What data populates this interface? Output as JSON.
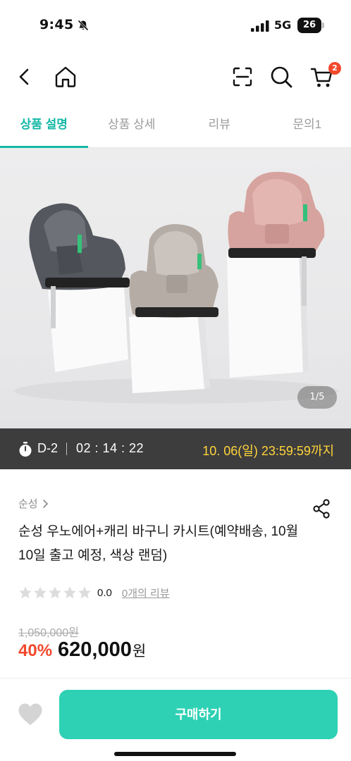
{
  "status_bar": {
    "time": "9:45",
    "network": "5G",
    "battery": "26"
  },
  "nav": {
    "back_icon": "chevron-left-icon",
    "home_icon": "home-icon",
    "scan_icon": "scan-icon",
    "search_icon": "search-icon",
    "cart_icon": "cart-icon",
    "cart_badge": "2"
  },
  "tabs": [
    {
      "label": "상품 설명",
      "active": true
    },
    {
      "label": "상품 상세",
      "active": false
    },
    {
      "label": "리뷰",
      "active": false
    },
    {
      "label": "문의1",
      "active": false
    }
  ],
  "gallery": {
    "pager": "1/5"
  },
  "timer": {
    "dday": "D-2",
    "countdown": "02 : 14 : 22",
    "deadline": "10. 06(일) 23:59:59까지"
  },
  "product": {
    "brand": "순성",
    "title": "순성 우노에어+캐리 바구니 카시트(예약배송, 10월 10일 출고 예정, 색상 랜덤)",
    "rating": "0.0",
    "review_link": "0개의 리뷰",
    "stars_filled": 0,
    "stars_total": 5,
    "original_price": "1,050,000원",
    "discount": "40%",
    "price": "620,000",
    "currency": "원"
  },
  "bottom_bar": {
    "buy_label": "구매하기",
    "wishlist_icon": "heart-icon"
  },
  "colors": {
    "accent": "#15b8a6",
    "buy_button": "#2ed1b3",
    "discount": "#f2492d",
    "deadline": "#ffd43b",
    "timer_bg": "#3d3d3d"
  }
}
